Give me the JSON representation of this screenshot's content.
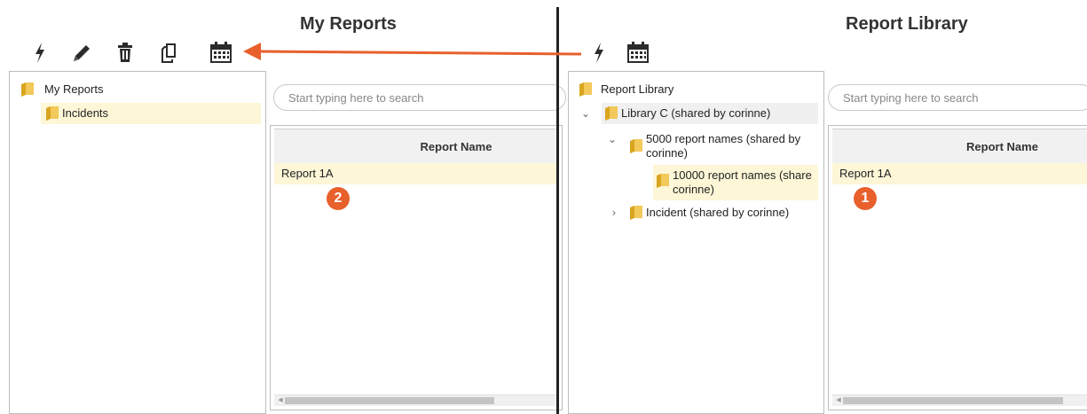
{
  "left_pane": {
    "title": "My Reports",
    "toolbar": [
      "lightning-icon",
      "pencil-icon",
      "trash-icon",
      "copy-icon",
      "calendar-icon"
    ],
    "tree": {
      "root": "My Reports",
      "children": [
        "Incidents"
      ]
    },
    "search": {
      "placeholder": "Start typing here to search"
    },
    "grid": {
      "column_header": "Report Name",
      "rows": [
        "Report 1A"
      ]
    },
    "badge": "2"
  },
  "right_pane": {
    "title": "Report Library",
    "toolbar": [
      "lightning-icon",
      "calendar-icon"
    ],
    "tree": {
      "root": "Report Library",
      "library_c": "Library C (shared by corinne)",
      "names_5000_line1": "5000 report names (shared by",
      "names_5000_line2": "corinne)",
      "names_10000_line1": "10000 report names (share",
      "names_10000_line2": "corinne)",
      "incident": "Incident (shared by corinne)"
    },
    "search": {
      "placeholder": "Start typing here to search"
    },
    "grid": {
      "column_header": "Report Name",
      "rows": [
        "Report 1A"
      ]
    },
    "badge": "1"
  },
  "colors": {
    "accent_orange": "#e8602c",
    "selection": "#fdf6d7",
    "folder": "#e6b422"
  }
}
